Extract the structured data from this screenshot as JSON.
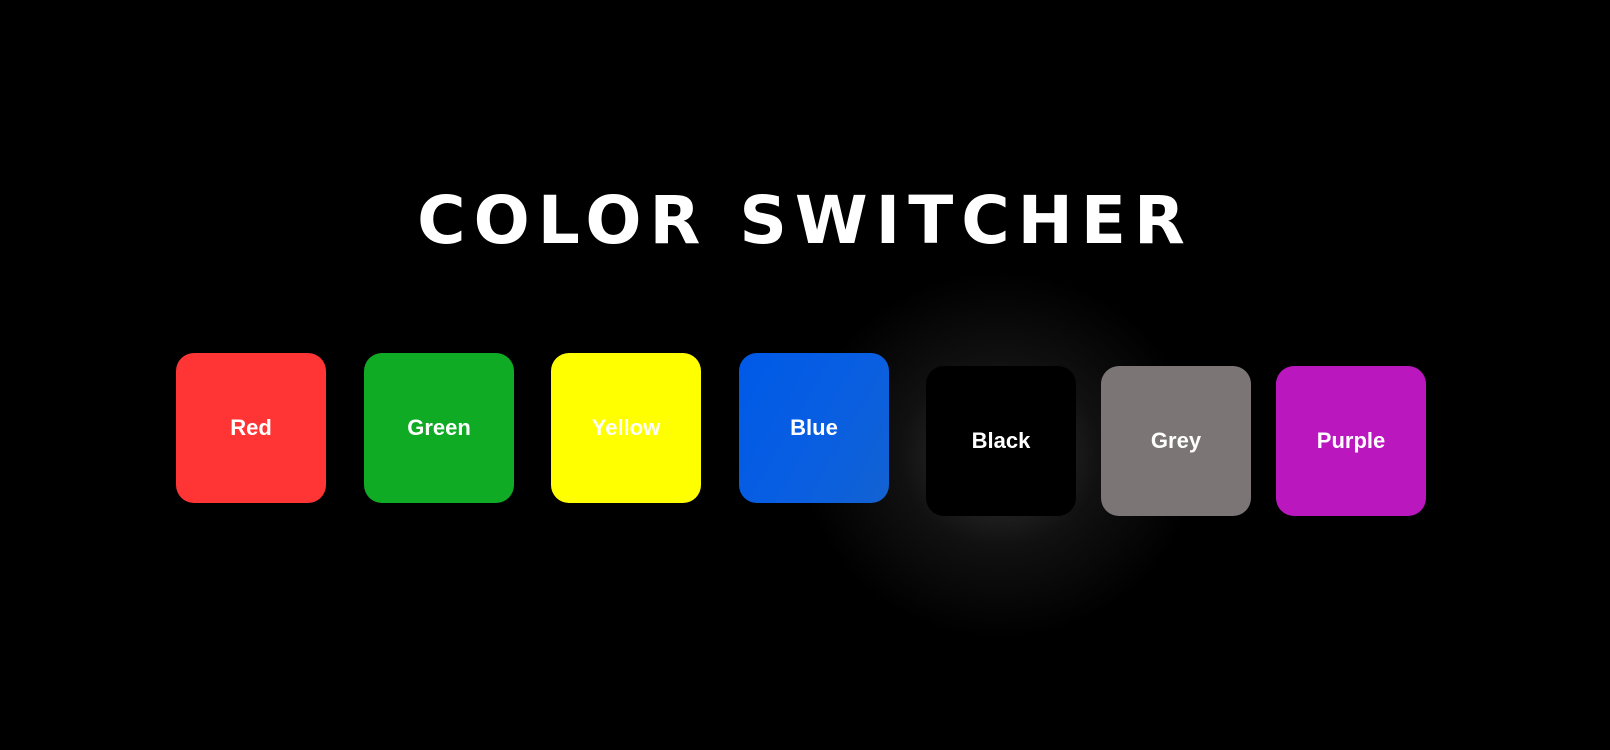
{
  "header": {
    "title": "COLOR SWITCHER"
  },
  "swatches": [
    {
      "label": "Red",
      "color": "#ff3535"
    },
    {
      "label": "Green",
      "color": "#10ab25"
    },
    {
      "label": "Yellow",
      "color": "#ffff00"
    },
    {
      "label": "Blue",
      "color": "#0a5fe0"
    },
    {
      "label": "Black",
      "color": "#000000",
      "state": "hovered"
    },
    {
      "label": "Grey",
      "color": "#7b7575"
    },
    {
      "label": "Purple",
      "color": "#bb17bf"
    }
  ],
  "theme": {
    "background": "#000000",
    "text": "#ffffff"
  }
}
